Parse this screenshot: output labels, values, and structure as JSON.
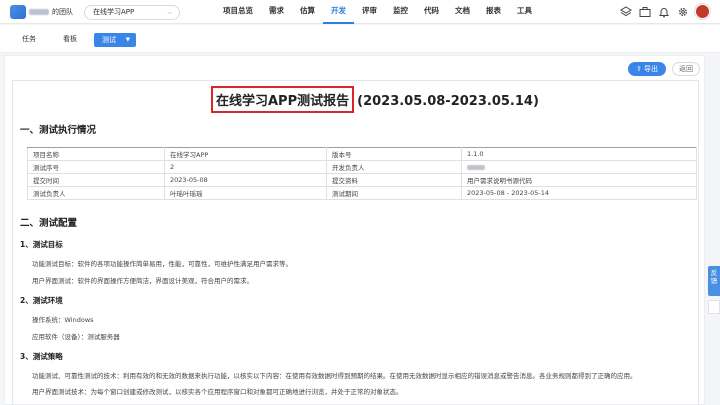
{
  "team": {
    "name": "的团队"
  },
  "project_select": {
    "value": "在线学习APP"
  },
  "nav": [
    {
      "label": "项目总览",
      "active": false
    },
    {
      "label": "需求",
      "active": false
    },
    {
      "label": "估算",
      "active": false
    },
    {
      "label": "开发",
      "active": true
    },
    {
      "label": "评审",
      "active": false
    },
    {
      "label": "监控",
      "active": false
    },
    {
      "label": "代码",
      "active": false
    },
    {
      "label": "文档",
      "active": false
    },
    {
      "label": "报表",
      "active": false
    },
    {
      "label": "工具",
      "active": false
    }
  ],
  "subtabs": {
    "task": "任务",
    "board": "看板",
    "test": "测试"
  },
  "toolbar": {
    "export_label": "导出",
    "back_label": "返回"
  },
  "report": {
    "title": "在线学习APP测试报告",
    "date_range": "(2023.05.08-2023.05.14)",
    "section1": "一、测试执行情况",
    "table": [
      [
        "项目名称",
        "在线学习APP",
        "版本号",
        "1.1.0"
      ],
      [
        "测试序号",
        "2",
        "开发负责人",
        ""
      ],
      [
        "提交时间",
        "2023-05-08",
        "提交资料",
        "用户需求说明书源代码"
      ],
      [
        "测试负责人",
        "叶瑶叶瑶瑶",
        "测试期间",
        "2023-05-08 - 2023-05-14"
      ]
    ],
    "section2": "二、测试配置",
    "sub1": "1、测试目标",
    "goal_func": "功能测试目标：软件的各项功能操作简单易用，性能，可靠性，可维护性满足用户需求等。",
    "goal_ui": "用户界面测试：软件的界面操作方便简洁，界面设计美观，符合用户的需求。",
    "sub2": "2、测试环境",
    "env_os": "操作系统：Windows",
    "env_app": "应用软件（设备）：测试服务器",
    "sub3": "3、测试策略",
    "strategy_func": "功能测试、可靠性测试的技术：利用有效的和无效的数据来执行功能，以核实以下内容：在使用有效数据时得到预期的结果。在使用无效数据时显示相应的错误消息或警告消息。各业务规则都得到了正确的应用。",
    "strategy_ui": "用户界面测试技术：为每个窗口创建或修改测试，以核实各个应用程序窗口和对象都可正确地进行浏览，并处于正常的对象状态。"
  },
  "float": {
    "feedback": "反馈"
  },
  "colors": {
    "accent": "#3a86e8",
    "title_box": "#d9252c"
  }
}
